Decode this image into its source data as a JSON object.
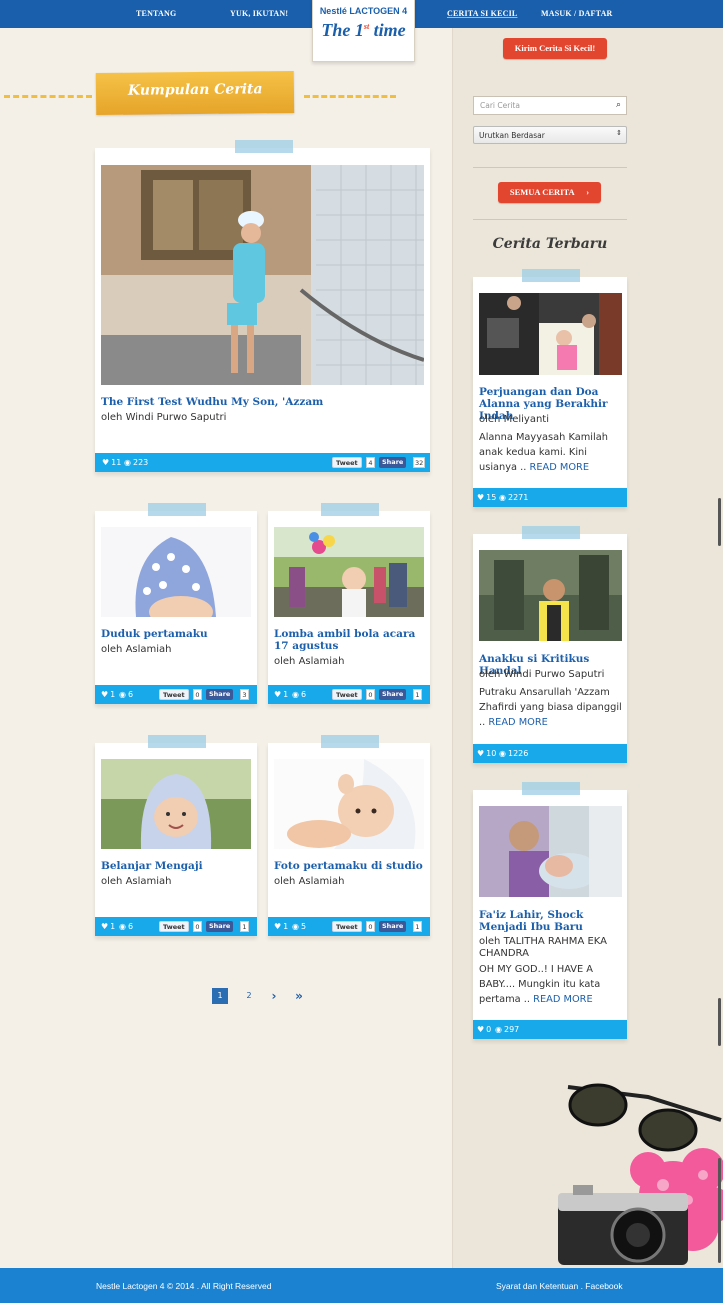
{
  "nav": {
    "items": [
      "TENTANG",
      "YUK, IKUTAN!",
      "CERITA SI KECIL",
      "MASUK / DAFTAR"
    ],
    "logo_brand": "Nestlé LACTOGEN 4",
    "logo_title": "The 1",
    "logo_sup": "st",
    "logo_title_end": "time"
  },
  "kirim_button": "Kirim Cerita Si Kecil!",
  "section_title": "Kumpulan Cerita",
  "sidebar": {
    "search_placeholder": "Cari Cerita",
    "sort_label": "Urutkan Berdasar",
    "all_stories_button": "SEMUA CERITA",
    "recent_heading": "Cerita Terbaru",
    "recent": [
      {
        "title": "Perjuangan dan Doa Alanna yang Berakhir Indah",
        "author": "oleh Meliyanti",
        "excerpt": "Alanna Mayyasah Kamilah anak kedua kami. Kini usianya ..",
        "readmore": "READ MORE",
        "likes": "15",
        "views": "2271"
      },
      {
        "title": "Anakku si Kritikus Handal",
        "author": "oleh Windi Purwo Saputri",
        "excerpt": "Putraku Ansarullah 'Azzam Zhafirdi yang biasa dipanggil ..",
        "readmore": "READ MORE",
        "likes": "10",
        "views": "1226"
      },
      {
        "title": "Fa'iz Lahir, Shock Menjadi Ibu Baru",
        "author": "oleh TALITHA RAHMA EKA CHANDRA",
        "excerpt": "OH MY GOD..! I HAVE A BABY.... Mungkin itu kata pertama ..",
        "readmore": "READ MORE",
        "likes": "0",
        "views": "297"
      }
    ]
  },
  "stories": [
    {
      "title": "The First Test Wudhu My Son, 'Azzam",
      "author": "oleh Windi Purwo Saputri",
      "likes": "11",
      "views": "223",
      "tweets": "4",
      "shares": "32"
    },
    {
      "title": "Duduk pertamaku",
      "author": "oleh Aslamiah",
      "likes": "1",
      "views": "6",
      "tweets": "0",
      "shares": "3"
    },
    {
      "title": "Lomba ambil bola acara 17 agustus",
      "author": "oleh Aslamiah",
      "likes": "1",
      "views": "6",
      "tweets": "0",
      "shares": "1"
    },
    {
      "title": "Belanjar Mengaji",
      "author": "oleh Aslamiah",
      "likes": "1",
      "views": "6",
      "tweets": "0",
      "shares": "1"
    },
    {
      "title": "Foto pertamaku di studio",
      "author": "oleh Aslamiah",
      "likes": "1",
      "views": "5",
      "tweets": "0",
      "shares": "1"
    }
  ],
  "social": {
    "tweet_label": "Tweet",
    "share_label": "Share"
  },
  "pagination": {
    "pages": [
      "1",
      "2"
    ],
    "next": "›",
    "last": "»"
  },
  "footer": {
    "left": "Nestle Lactogen 4 © 2014 . All Right Reserved",
    "right": "Syarat dan Ketentuan . Facebook"
  },
  "colors": {
    "nav": "#1a5fab",
    "accent_blue": "#17a9ea",
    "accent_red": "#e3462f",
    "banner": "#f0b338",
    "title_blue": "#1c5fab"
  }
}
